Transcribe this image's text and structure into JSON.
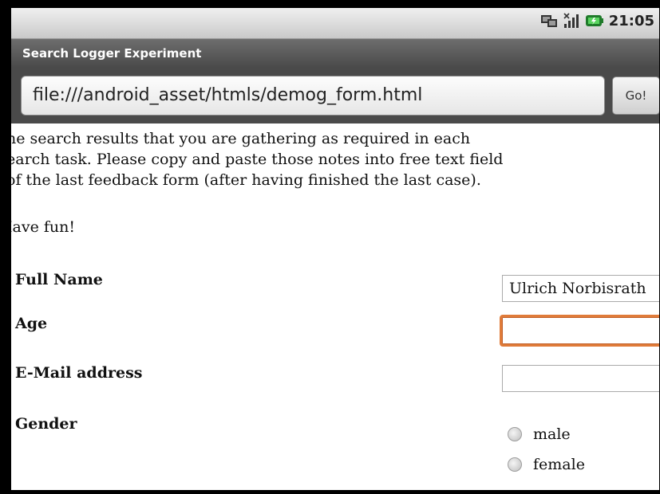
{
  "statusbar": {
    "clock": "21:05",
    "icons": [
      "network-sync-icon",
      "signal-icon",
      "battery-icon"
    ]
  },
  "app": {
    "title": "Search Logger Experiment"
  },
  "browser": {
    "url": "file:///android_asset/htmls/demog_form.html",
    "go_label": "Go!"
  },
  "page": {
    "intro_lines": [
      "he search results that you are gathering as required in each",
      "earch task. Please copy and paste those notes into free text field",
      "of the last feedback form (after having finished the last case)."
    ],
    "have_fun": "Iave fun!",
    "form": {
      "full_name_label": "Full Name",
      "full_name_value": "Ulrich Norbisrath",
      "age_label": "Age",
      "age_value": "",
      "email_label": "E-Mail address",
      "email_value": "",
      "gender_label": "Gender",
      "gender_options": [
        "male",
        "female"
      ]
    }
  }
}
